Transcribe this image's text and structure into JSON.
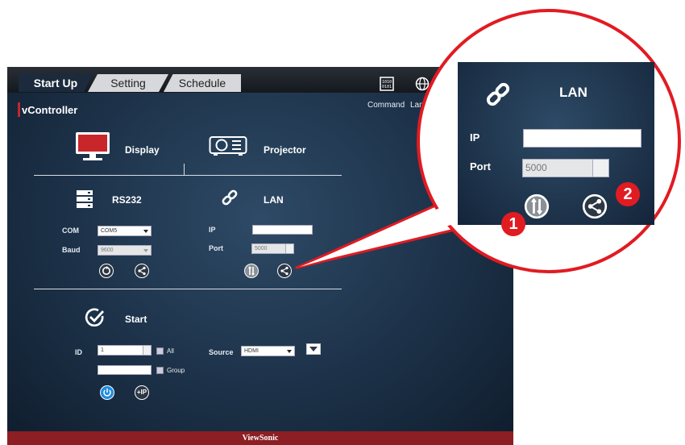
{
  "tabs": [
    {
      "label": "Start Up",
      "active": true
    },
    {
      "label": "Setting",
      "active": false
    },
    {
      "label": "Schedule",
      "active": false
    }
  ],
  "toolbar": {
    "command_label": "Command",
    "language_label": "Lan"
  },
  "app_title": "vController",
  "devices": {
    "display_label": "Display",
    "projector_label": "Projector"
  },
  "rs232": {
    "title": "RS232",
    "com_label": "COM",
    "com_value": "COM5",
    "baud_label": "Baud",
    "baud_value": "9600"
  },
  "lan": {
    "title": "LAN",
    "ip_label": "IP",
    "ip_value": "",
    "port_label": "Port",
    "port_value": "5000"
  },
  "start": {
    "title": "Start",
    "id_label": "ID",
    "id_value": "1",
    "all_label": "All",
    "group_label": "Group",
    "group_value": "",
    "source_label": "Source",
    "source_value": "HDMI",
    "ip_button_label": "+IP"
  },
  "footer": {
    "brand": "ViewSonic"
  },
  "zoom": {
    "title": "LAN",
    "ip_label": "IP",
    "ip_value": "",
    "port_label": "Port",
    "port_value": "5000",
    "badge_1": "1",
    "badge_2": "2"
  },
  "colors": {
    "accent_red": "#e11b22",
    "footer_red": "#8b1f23",
    "background_blue": "#1c3148",
    "power_blue": "#1f8de0"
  }
}
